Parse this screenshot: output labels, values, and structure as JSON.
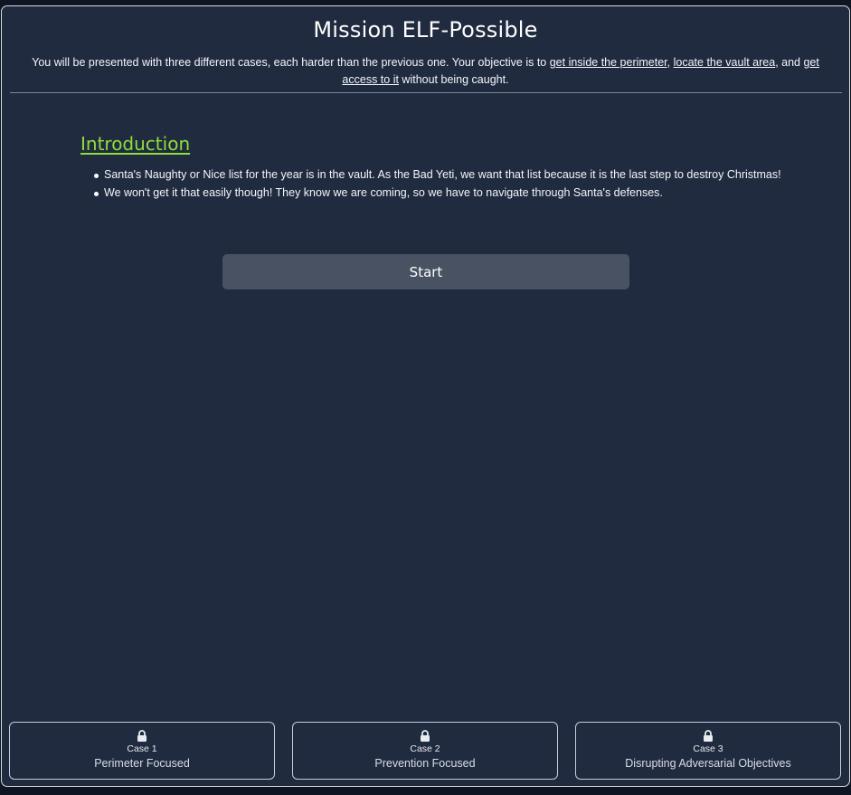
{
  "page": {
    "title": "Mission ELF-Possible",
    "subtitle": {
      "text_before": "You will be presented with three different cases, each harder than the previous one. Your objective is to ",
      "link1": "get inside the perimeter",
      "sep1": ", ",
      "link2": "locate the vault area",
      "sep2": ", and ",
      "link3": "get access to it",
      "text_after": " without being caught."
    }
  },
  "introduction": {
    "heading": "Introduction",
    "items": [
      "Santa's Naughty or Nice list for the year is in the vault. As the Bad Yeti, we want that list because it is the last step to destroy Christmas!",
      "We won't get it that easily though! They know we are coming, so we have to navigate through Santa's defenses."
    ]
  },
  "start_button": {
    "label": "Start"
  },
  "cases": [
    {
      "number_label": "Case 1",
      "name": "Perimeter Focused",
      "icon": "lock-icon",
      "locked": true
    },
    {
      "number_label": "Case 2",
      "name": "Prevention Focused",
      "icon": "lock-icon",
      "locked": true
    },
    {
      "number_label": "Case 3",
      "name": "Disrupting Adversarial Objectives",
      "icon": "lock-icon",
      "locked": true
    }
  ],
  "colors": {
    "background": "#212b40",
    "accent_heading": "#8fde3c",
    "button": "#495263",
    "border": "#d7dbe3"
  }
}
